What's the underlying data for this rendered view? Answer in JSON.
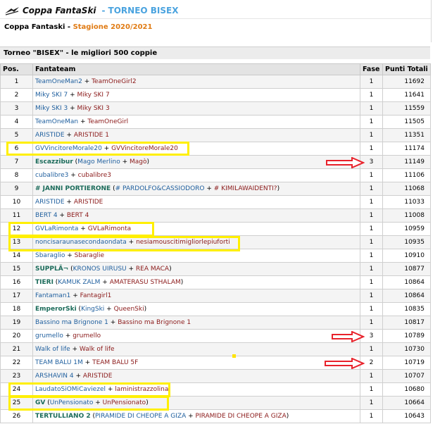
{
  "header": {
    "brand": "Coppa FantaSki",
    "separator": " - ",
    "tournament": "TORNEO BISEX",
    "crumb_main": "Coppa Fantaski",
    "crumb_sep": " - ",
    "crumb_season": "Stagione 2020/2021"
  },
  "section_title": "Torneo \"BISEX\" - le migliori 500 coppie",
  "columns": {
    "pos": "Pos.",
    "team": "Fantateam",
    "fase": "Fase",
    "points": "Punti Totali"
  },
  "colors": {
    "link_blue": "#1f5f9e",
    "link_red": "#8b1a1a",
    "team_green": "#1b6b5a",
    "highlight": "#ffef00",
    "arrow": "#e8222b",
    "season_orange": "#e07b14"
  },
  "rows": [
    {
      "pos": "1",
      "a": "TeamOneMan2",
      "b": "TeamOneGirl2",
      "fase": "1",
      "points": "11692"
    },
    {
      "pos": "2",
      "a": "Miky SKI 7",
      "b": "Miky SKI 7",
      "fase": "1",
      "points": "11641"
    },
    {
      "pos": "3",
      "a": "Miky SKI 3",
      "b": "Miky SKI 3",
      "fase": "1",
      "points": "11559"
    },
    {
      "pos": "4",
      "a": "TeamOneMan",
      "b": "TeamOneGirl",
      "fase": "1",
      "points": "11505"
    },
    {
      "pos": "5",
      "a": "ARISTIDE",
      "b": "ARISTIDE 1",
      "fase": "1",
      "points": "11351"
    },
    {
      "pos": "6",
      "a": "GVVincitoreMorale20",
      "b": "GVVincitoreMorale20",
      "fase": "1",
      "points": "11174"
    },
    {
      "pos": "7",
      "team": "Escazzibur",
      "open": " (",
      "a": "Mago Merlino",
      "b": "Magò",
      "close": ")",
      "fase": "3",
      "points": "11149"
    },
    {
      "pos": "8",
      "a": "cubalibre3",
      "b": "cubalibre3",
      "fase": "1",
      "points": "11106"
    },
    {
      "pos": "9",
      "team": "# JANNI PORTIERONE",
      "open": " (",
      "a": "# PARDOLFO&CASSIODORO",
      "b": "# KIMILAWAIDENTI?",
      "close": ")",
      "fase": "1",
      "points": "11068"
    },
    {
      "pos": "10",
      "a": "ARISTIDE",
      "b": "ARISTIDE",
      "fase": "1",
      "points": "11033"
    },
    {
      "pos": "11",
      "a": "BERT 4",
      "b": "BERT 4",
      "fase": "1",
      "points": "11008"
    },
    {
      "pos": "12",
      "a": "GVLaRimonta",
      "b": "GVLaRimonta",
      "fase": "1",
      "points": "10959"
    },
    {
      "pos": "13",
      "a": "noncisaraunasecondaondata",
      "b": "nesiamouscitimigliorlepiuforti",
      "fase": "1",
      "points": "10935"
    },
    {
      "pos": "14",
      "a": "Sbaraglio",
      "b": "Sbaraglie",
      "fase": "1",
      "points": "10910"
    },
    {
      "pos": "15",
      "team": "SUPPLÃ¬",
      "open": " (",
      "a": "KRONOS UIRUSU",
      "b": "REA MACA",
      "close": ")",
      "fase": "1",
      "points": "10877"
    },
    {
      "pos": "16",
      "team": "TIERI",
      "open": " (",
      "a": "KAMUK ZALM",
      "b": "AMATERASU STHALAM",
      "close": ")",
      "fase": "1",
      "points": "10864"
    },
    {
      "pos": "17",
      "a": "Fantaman1",
      "b": "Fantagirl1",
      "fase": "1",
      "points": "10864"
    },
    {
      "pos": "18",
      "team": "EmperorSki",
      "open": " (",
      "a": "KingSki",
      "b": "QueenSki",
      "close": ")",
      "fase": "1",
      "points": "10835"
    },
    {
      "pos": "19",
      "a": "Bassino ma Brignone 1",
      "b": "Bassino ma Brignone 1",
      "fase": "1",
      "points": "10817"
    },
    {
      "pos": "20",
      "a": "grumello",
      "b": "grumello",
      "fase": "3",
      "points": "10789"
    },
    {
      "pos": "21",
      "a": "Walk of life",
      "b": "Walk of life",
      "fase": "1",
      "points": "10730"
    },
    {
      "pos": "22",
      "a": "TEAM BALU 1M",
      "b": "TEAM BALU 5F",
      "fase": "2",
      "points": "10719"
    },
    {
      "pos": "23",
      "a": "ARSHAVIN 4",
      "b": "ARISTIDE",
      "fase": "1",
      "points": "10707"
    },
    {
      "pos": "24",
      "a": "LaudatoSiOMiCaviezel",
      "b": "laministrazzolina",
      "fase": "1",
      "points": "10680"
    },
    {
      "pos": "25",
      "team": "GV",
      "open": " (",
      "a": "UnPensionato",
      "b": "UnPensionato",
      "close": ")",
      "fase": "1",
      "points": "10664"
    },
    {
      "pos": "26",
      "team": "TERTULLIANO 2",
      "open": " (",
      "a": "PIRAMIDE DI CHEOPE A GIZA",
      "b": "PIRAMIDE DI CHEOPE A GIZA",
      "close": ")",
      "fase": "1",
      "points": "10643"
    }
  ]
}
